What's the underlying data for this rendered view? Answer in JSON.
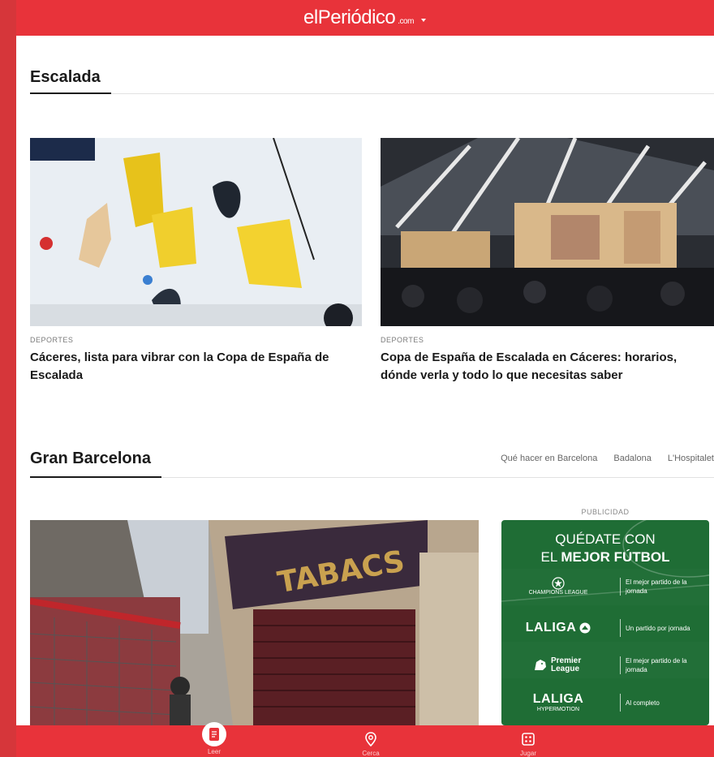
{
  "header": {
    "logo_main": "elPeriódico",
    "logo_suffix": ".com"
  },
  "sections": {
    "escalada": {
      "title": "Escalada",
      "cards": [
        {
          "kicker": "DEPORTES",
          "headline": "Cáceres, lista para vibrar con la Copa de España de Escalada"
        },
        {
          "kicker": "DEPORTES",
          "headline": "Copa de España de Escalada en Cáceres: horarios, dónde verla y todo lo que necesitas saber"
        }
      ]
    },
    "gran_barcelona": {
      "title": "Gran Barcelona",
      "links": [
        "Qué hacer en Barcelona",
        "Badalona",
        "L'Hospitalet"
      ],
      "photo_sign": "TABACS"
    }
  },
  "ad": {
    "label": "PUBLICIDAD",
    "head_line1": "QUÉDATE CON",
    "head_line2_prefix": "EL",
    "head_line2_bold": "MEJOR FÚTBOL",
    "rows": [
      {
        "brand": "CHAMPIONS LEAGUE",
        "desc": "El mejor partido de la jornada"
      },
      {
        "brand": "LALIGA",
        "desc": "Un partido por jornada"
      },
      {
        "brand": "Premier League",
        "desc": "El mejor partido de la jornada"
      },
      {
        "brand": "LALIGA",
        "brand_sub": "HYPERMOTION",
        "desc": "Al completo"
      }
    ]
  },
  "tabs": [
    {
      "label": "Leer",
      "icon": "document-icon",
      "active": true
    },
    {
      "label": "Cerca",
      "icon": "location-pin-icon",
      "active": false
    },
    {
      "label": "Jugar",
      "icon": "dice-icon",
      "active": false
    }
  ],
  "colors": {
    "brand_red": "#e8333a",
    "ad_green": "#1f6d35",
    "text": "#1a1a1a"
  }
}
